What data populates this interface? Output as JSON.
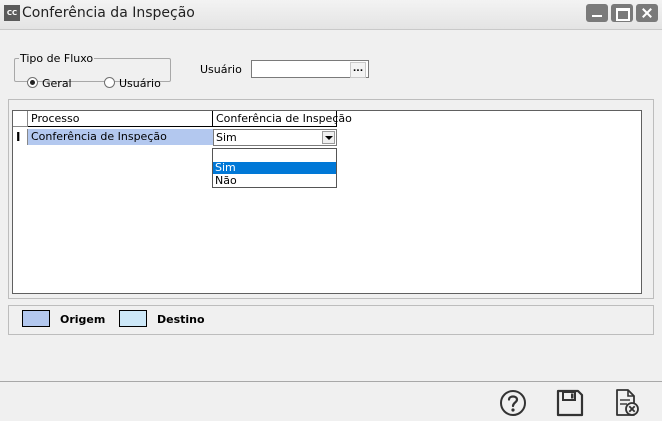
{
  "window": {
    "title": "Conferência da Inspeção",
    "app_icon_text": "CC"
  },
  "filters": {
    "flow_group_label": "Tipo de Fluxo",
    "options": [
      {
        "label": "Geral",
        "selected": true
      },
      {
        "label": "Usuário",
        "selected": false
      }
    ],
    "user_label": "Usuário",
    "user_value": "",
    "ellipsis": "..."
  },
  "grid": {
    "columns": [
      "Processo",
      "Conferência de Inspeção"
    ],
    "rows": [
      {
        "indicator": "I",
        "processo": "Conferência de Inspeção",
        "conferencia": "Sim"
      }
    ],
    "dropdown_options": [
      "",
      "Sim",
      "Não"
    ],
    "dropdown_selected": "Sim"
  },
  "legend": {
    "origem": "Origem",
    "destino": "Destino",
    "origem_color": "#b3c8ef",
    "destino_color": "#cde8f8"
  },
  "toolbar": {
    "icons": [
      "help-icon",
      "save-icon",
      "cancel-document-icon"
    ]
  }
}
